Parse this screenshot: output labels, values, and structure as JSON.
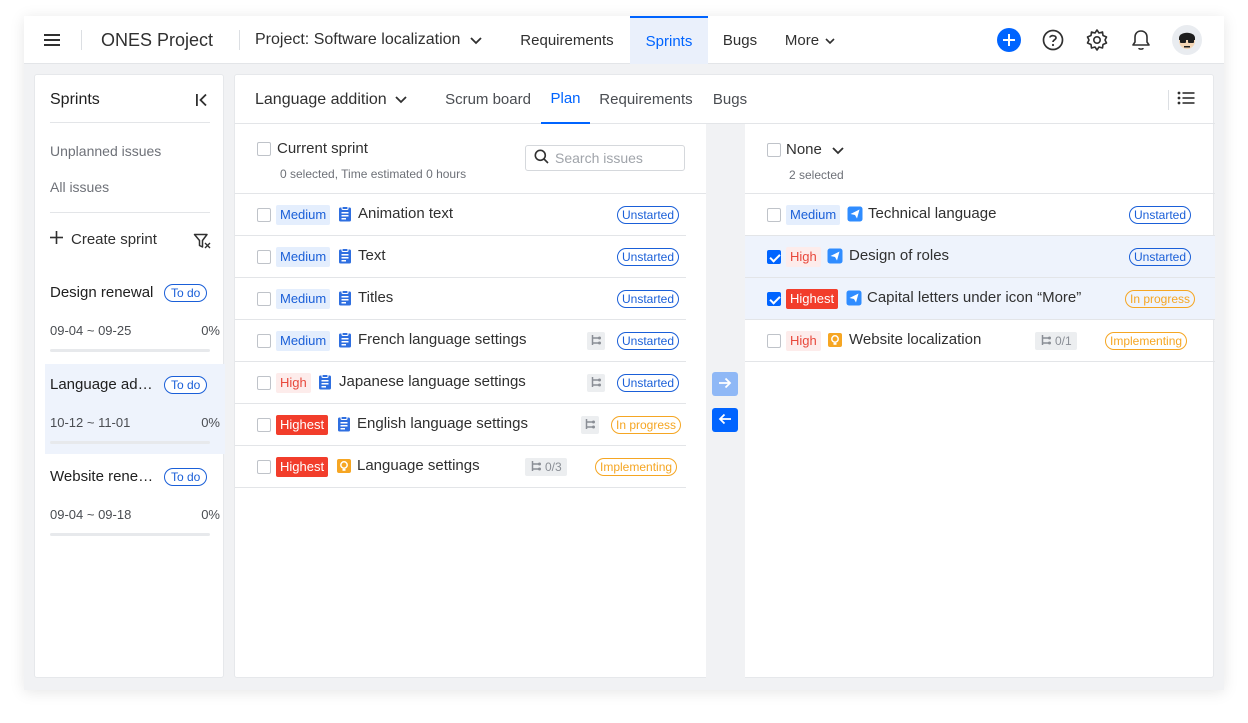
{
  "topbar": {
    "menu_icon": "hamburger-icon",
    "app_title": "ONES Project",
    "project_label": "Project: Software localization",
    "tabs": [
      "Requirements",
      "Sprints",
      "Bugs",
      "More"
    ],
    "active_tab": "Sprints"
  },
  "sidebar": {
    "title": "Sprints",
    "links": [
      "Unplanned issues",
      "All issues"
    ],
    "create_label": "Create sprint",
    "sprints": [
      {
        "name": "Design renewal",
        "status": "To do",
        "dates": "09-04 ~ 09-25",
        "progress": "0%"
      },
      {
        "name": "Language addition",
        "status": "To do",
        "dates": "10-12 ~ 11-01",
        "progress": "0%"
      },
      {
        "name": "Website renewal",
        "status": "To do",
        "dates": "09-04 ~ 09-18",
        "progress": "0%"
      }
    ]
  },
  "main": {
    "sprint_name": "Language addition",
    "tabs": [
      "Scrum board",
      "Plan",
      "Requirements",
      "Bugs"
    ],
    "active_tab": "Plan"
  },
  "left_pane": {
    "title": "Current sprint",
    "subtitle": "0 selected, Time estimated 0 hours",
    "search_placeholder": "Search issues",
    "rows": [
      {
        "priority": "Medium",
        "type": "task",
        "title": "Animation text",
        "subtasks": "",
        "status": "Unstarted",
        "checked": false
      },
      {
        "priority": "Medium",
        "type": "task",
        "title": "Text",
        "subtasks": "",
        "status": "Unstarted",
        "checked": false
      },
      {
        "priority": "Medium",
        "type": "task",
        "title": "Titles",
        "subtasks": "",
        "status": "Unstarted",
        "checked": false
      },
      {
        "priority": "Medium",
        "type": "task",
        "title": "French language settings",
        "subtasks": "",
        "status": "Unstarted",
        "checked": false
      },
      {
        "priority": "High",
        "type": "task",
        "title": "Japanese language settings",
        "subtasks": "",
        "status": "Unstarted",
        "checked": false
      },
      {
        "priority": "Highest",
        "type": "task",
        "title": "English language settings",
        "subtasks": "",
        "status": "In progress",
        "checked": false
      },
      {
        "priority": "Highest",
        "type": "requirement",
        "title": "Language settings",
        "subtasks": "0/3",
        "status": "Implementing",
        "checked": false
      }
    ]
  },
  "right_pane": {
    "title": "None",
    "subtitle": "2 selected",
    "rows": [
      {
        "priority": "Medium",
        "type": "bug",
        "title": "Technical language",
        "subtasks": "",
        "status": "Unstarted",
        "checked": false
      },
      {
        "priority": "High",
        "type": "bug",
        "title": "Design of roles",
        "subtasks": "",
        "status": "Unstarted",
        "checked": true
      },
      {
        "priority": "Highest",
        "type": "bug",
        "title": "Capital letters under icon “More”",
        "subtasks": "",
        "status": "In progress",
        "checked": true
      },
      {
        "priority": "High",
        "type": "requirement",
        "title": "Website localization",
        "subtasks": "0/1",
        "status": "Implementing",
        "checked": false
      }
    ]
  },
  "colors": {
    "accent": "#0064ff",
    "medium": "#1a5fd8",
    "high": "#e8483b",
    "highest": "#f23d2b",
    "in_progress": "#f5a623"
  }
}
